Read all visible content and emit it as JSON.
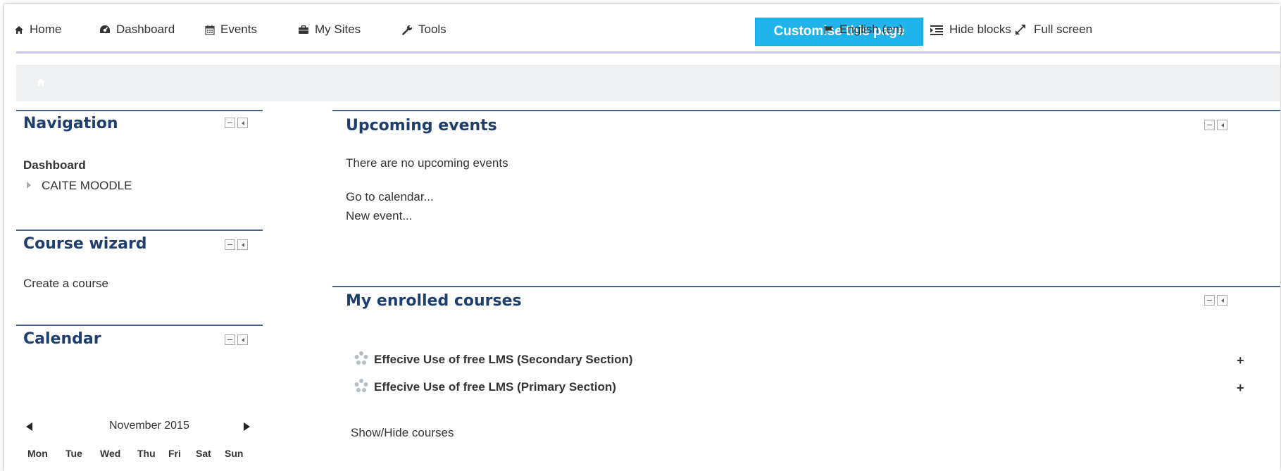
{
  "topbar": {
    "home": "Home",
    "dashboard": "Dashboard",
    "events": "Events",
    "my_sites": "My Sites",
    "tools": "Tools",
    "customise": "Customise this page",
    "language": "English (en)",
    "hide_blocks": "Hide blocks",
    "full_screen": "Full screen"
  },
  "navigation": {
    "title": "Navigation",
    "dashboard": "Dashboard",
    "site": "CAITE MOODLE"
  },
  "course_wizard": {
    "title": "Course wizard",
    "create": "Create a course"
  },
  "calendar": {
    "title": "Calendar",
    "month": "November 2015",
    "days": [
      "Mon",
      "Tue",
      "Wed",
      "Thu",
      "Fri",
      "Sat",
      "Sun"
    ]
  },
  "upcoming_events": {
    "title": "Upcoming events",
    "empty": "There are no upcoming events",
    "go_to_calendar": "Go to calendar...",
    "new_event": "New event..."
  },
  "enrolled_courses": {
    "title": "My enrolled courses",
    "courses": [
      {
        "name": "Effecive Use of free LMS (Secondary Section)",
        "expand": "+"
      },
      {
        "name": "Effecive Use of free LMS (Primary Section)",
        "expand": "+"
      }
    ],
    "show_hide": "Show/Hide courses"
  },
  "colors": {
    "accent": "#1fb5ea",
    "block_title": "#1e3f6d",
    "block_rule": "#45638a"
  }
}
